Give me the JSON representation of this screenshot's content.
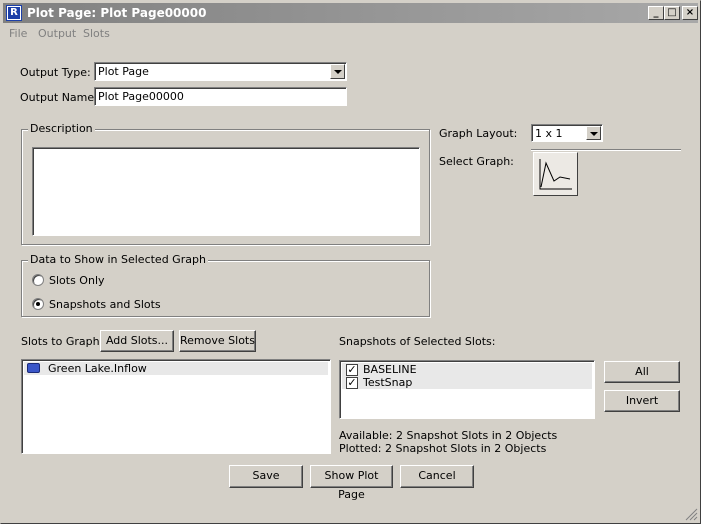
{
  "window": {
    "title": "Plot Page: Plot Page00000",
    "minimize_label": "_",
    "maximize_label": "□",
    "close_label": "×"
  },
  "menu": {
    "file": "File",
    "output": "Output",
    "slots": "Slots"
  },
  "output": {
    "type_label": "Output Type:",
    "type_value": "Plot Page",
    "name_label": "Output Name:",
    "name_value": "Plot Page00000"
  },
  "description": {
    "title": "Description",
    "value": ""
  },
  "graph": {
    "layout_label": "Graph Layout:",
    "layout_value": "1 x 1",
    "select_label": "Select Graph:"
  },
  "data_show": {
    "title": "Data to Show in Selected Graph",
    "options": [
      {
        "label": "Slots Only",
        "selected": false
      },
      {
        "label": "Snapshots and Slots",
        "selected": true
      }
    ]
  },
  "slots": {
    "label": "Slots to Graph:",
    "add_button": "Add Slots...",
    "remove_button": "Remove Slots",
    "items": [
      "Green Lake.Inflow"
    ]
  },
  "snapshots": {
    "label": "Snapshots of Selected Slots:",
    "items": [
      {
        "label": "BASELINE",
        "checked": true
      },
      {
        "label": "TestSnap",
        "checked": true
      }
    ],
    "all_button": "All",
    "invert_button": "Invert",
    "available": "Available:  2 Snapshot Slots in 2 Objects",
    "plotted": "Plotted:  2 Snapshot Slots in 2 Objects"
  },
  "footer": {
    "save": "Save",
    "show_plot": "Show Plot Page",
    "cancel": "Cancel"
  }
}
